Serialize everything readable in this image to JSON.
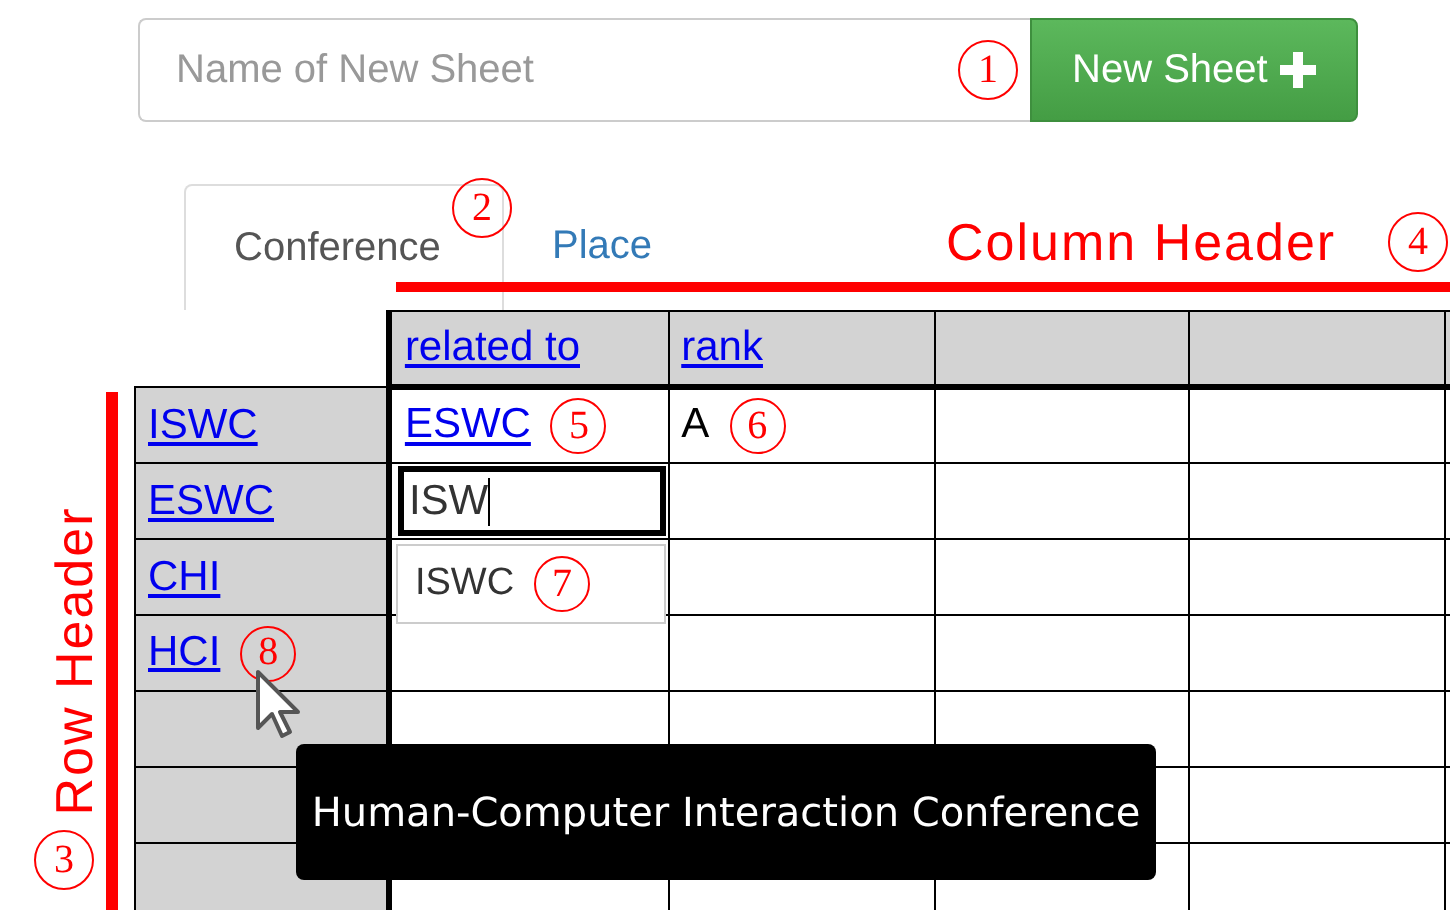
{
  "new_sheet": {
    "placeholder": "Name of New Sheet",
    "button": "New Sheet",
    "marker": "1"
  },
  "tabs": [
    {
      "label": "Conference",
      "selected": true,
      "marker": "2"
    },
    {
      "label": "Place",
      "selected": false
    }
  ],
  "column_header_note": {
    "label": "Column Header",
    "marker": "4"
  },
  "row_header_note": {
    "label": "Row Header",
    "marker": "3"
  },
  "grid": {
    "columns": [
      "related to",
      "rank"
    ],
    "rows": [
      {
        "header": "ISWC",
        "cells": [
          {
            "kind": "link",
            "text": "ESWC",
            "marker": "5"
          },
          {
            "kind": "plain",
            "text": "A",
            "marker": "6"
          }
        ]
      },
      {
        "header": "ESWC",
        "cells": [
          {
            "kind": "editing",
            "value": "ISW",
            "suggestion": "ISWC",
            "marker": "7"
          }
        ]
      },
      {
        "header": "CHI"
      },
      {
        "header": "HCI",
        "marker": "8"
      }
    ]
  },
  "tooltip": "Human-Computer Interaction Conference"
}
